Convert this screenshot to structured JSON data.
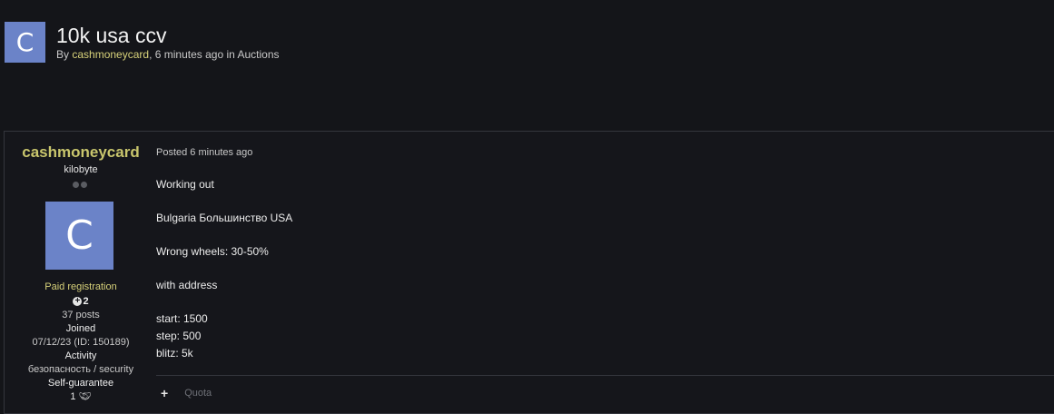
{
  "topic": {
    "avatar_letter": "C",
    "title": "10k usa ccv",
    "by_prefix": "By ",
    "author": "cashmoneycard",
    "time_text": ", 6 minutes ago in ",
    "forum": "Auctions"
  },
  "post": {
    "author": {
      "name": "cashmoneycard",
      "rank": "kilobyte",
      "avatar_letter": "C",
      "group": "Paid registration",
      "reputation": "2",
      "posts": "37 posts",
      "joined_label": "Joined",
      "joined_value": "07/12/23 (ID: 150189)",
      "activity_label": "Activity",
      "activity_value": "безопасность / security",
      "guarantee_label": "Self-guarantee",
      "guarantee_value": "1"
    },
    "posted": "Posted 6 minutes ago",
    "content": {
      "p1": "Working out",
      "p2": "Bulgaria Большинство USA",
      "p3": "Wrong wheels: 30-50%",
      "p4": "with address",
      "start": "start: 1500",
      "step": "step: 500",
      "blitz": "blitz: 5k"
    },
    "actions": {
      "add_icon": "plus-icon",
      "quote_label": "Quota"
    }
  }
}
